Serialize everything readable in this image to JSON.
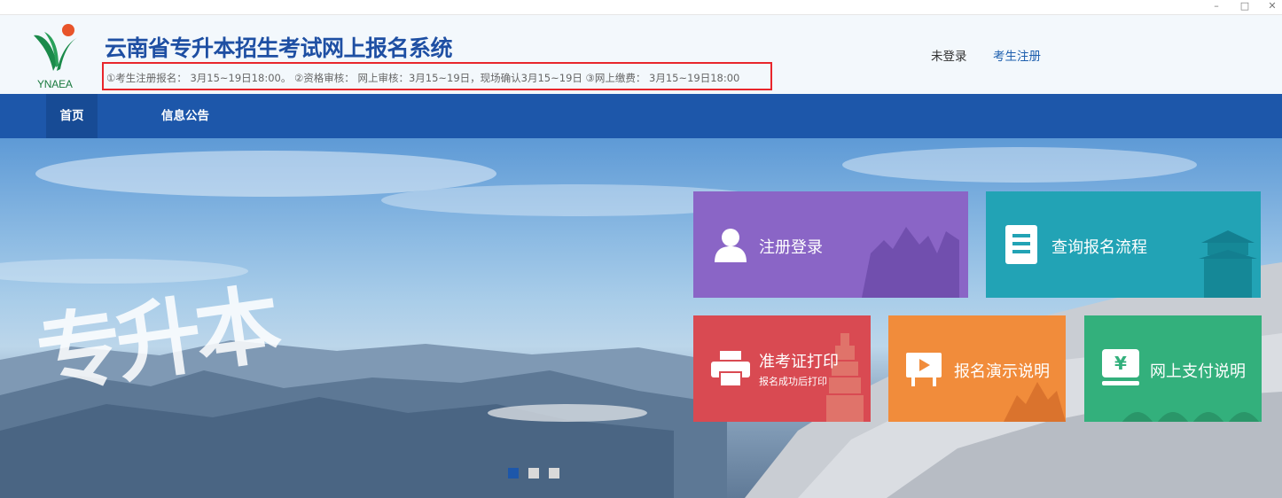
{
  "header": {
    "logo_text": "YNAEA",
    "title": "云南省专升本招生考试网上报名系统",
    "notice": "①考生注册报名： 3月15~19日18:00。 ②资格审核： 网上审核：3月15~19日，现场确认3月15~19日 ③网上缴费： 3月15~19日18:00",
    "login_status": "未登录",
    "register_link": "考生注册"
  },
  "nav": {
    "items": [
      {
        "label": "首页",
        "active": true
      },
      {
        "label": "信息公告",
        "active": false
      }
    ]
  },
  "banner": {
    "calligraphy": "专升本"
  },
  "tiles": [
    {
      "label": "注册登录",
      "icon": "user-icon",
      "color": "#8a65c6"
    },
    {
      "label": "查询报名流程",
      "icon": "document-icon",
      "color": "#22a3b5"
    },
    {
      "label": "准考证打印",
      "sub": "报名成功后打印",
      "icon": "printer-icon",
      "color": "#d94a52"
    },
    {
      "label": "报名演示说明",
      "icon": "play-screen-icon",
      "color": "#f18c3b"
    },
    {
      "label": "网上支付说明",
      "icon": "yen-icon",
      "color": "#33b07c"
    }
  ],
  "carousel": {
    "active_index": 0,
    "count": 3,
    "active_color": "#1d57aa",
    "inactive_color": "#d9d9d9"
  },
  "colors": {
    "brand": "#1e4fa3",
    "nav_bg": "#1d57aa",
    "notice_border": "#e8262c"
  }
}
